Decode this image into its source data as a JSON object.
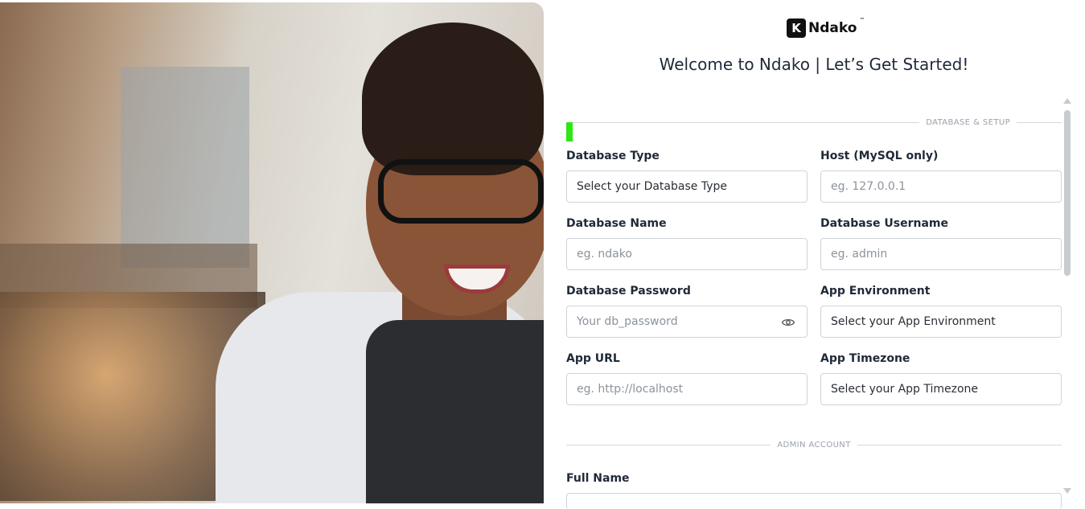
{
  "brand": {
    "logo_letter": "K",
    "logo_text": "Ndako",
    "logo_mark": "™"
  },
  "header": {
    "title": "Welcome to Ndako | Let’s Get Started!"
  },
  "sections": {
    "database": "DATABASE & SETUP",
    "admin": "ADMIN ACCOUNT"
  },
  "progress": {
    "percent": 1
  },
  "fields": {
    "db_type": {
      "label": "Database Type",
      "value": "Select your Database Type"
    },
    "host": {
      "label": "Host (MySQL only)",
      "placeholder": "eg. 127.0.0.1"
    },
    "db_name": {
      "label": "Database Name",
      "placeholder": "eg. ndako"
    },
    "db_user": {
      "label": "Database Username",
      "placeholder": "eg. admin"
    },
    "db_pass": {
      "label": "Database Password",
      "placeholder": "Your db_password"
    },
    "app_env": {
      "label": "App Environment",
      "value": "Select your App Environment"
    },
    "app_url": {
      "label": "App URL",
      "placeholder": "eg. http://localhost"
    },
    "app_tz": {
      "label": "App Timezone",
      "value": "Select your App Timezone"
    },
    "full_name": {
      "label": "Full Name"
    }
  },
  "icons": {
    "eye": "eye-icon"
  },
  "colors": {
    "progress": "#2ee714"
  }
}
